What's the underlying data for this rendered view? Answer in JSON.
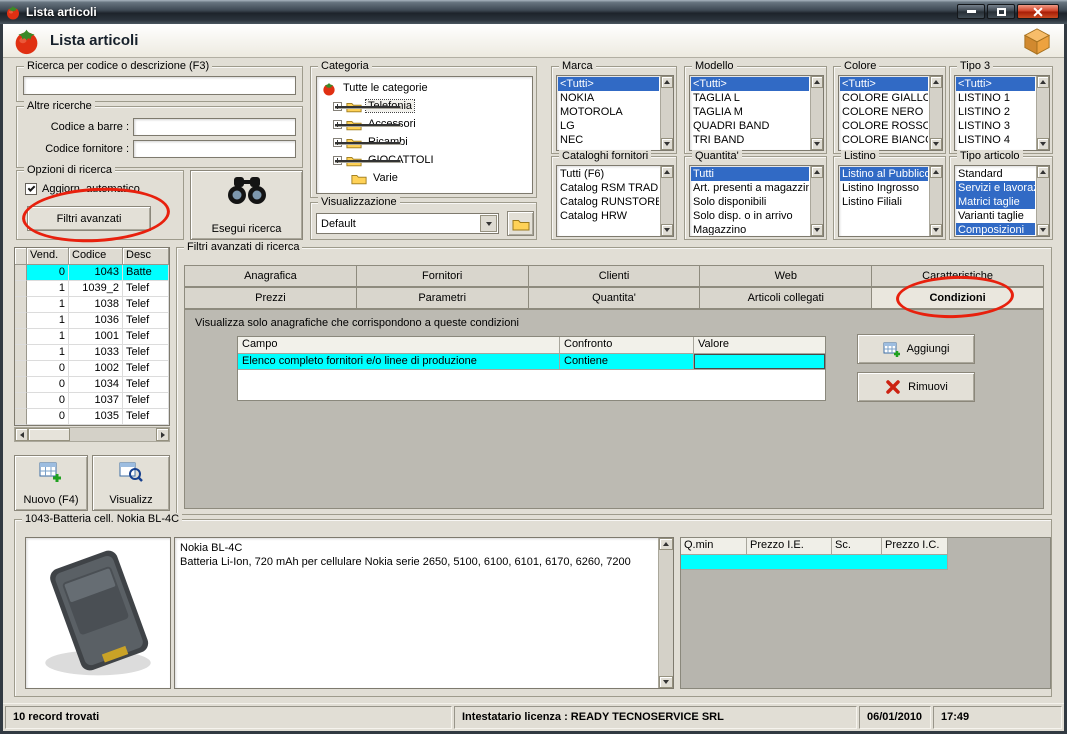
{
  "titlebar": {
    "title": "Lista articoli"
  },
  "header": {
    "title": "Lista articoli"
  },
  "colors": {
    "selection_blue": "#316AC5",
    "row_highlight_cyan": "#00FFFF",
    "annotation_red": "#E8200D",
    "window_gray": "#E1DED5",
    "panel_gray": "#BCBAB2"
  },
  "search": {
    "ricerca_group_label": "Ricerca per codice o descrizione (F3)",
    "ricerca_value": "",
    "altre_label": "Altre ricerche",
    "codice_barre_label": "Codice a barre :",
    "codice_barre_value": "",
    "codice_fornitore_label": "Codice fornitore :",
    "codice_fornitore_value": "",
    "opzioni_label": "Opzioni di ricerca",
    "aggiorn_checkbox_label": "Aggiorn. automatico",
    "filtri_avanzati_label": "Filtri avanzati",
    "esegui_label": "Esegui ricerca"
  },
  "categoria": {
    "group_label": "Categoria",
    "items": [
      {
        "label": "Tutte le categorie"
      },
      {
        "label": "Telefonia"
      },
      {
        "label": "Accessori"
      },
      {
        "label": "Ricambi"
      },
      {
        "label": "GIOCATTOLI"
      },
      {
        "label": "Varie"
      }
    ]
  },
  "visualizzazione": {
    "group_label": "Visualizzazione",
    "value": "Default"
  },
  "filters": {
    "marca": {
      "label": "Marca",
      "items": [
        {
          "label": "<Tutti>",
          "sel": true
        },
        {
          "label": "NOKIA"
        },
        {
          "label": "MOTOROLA"
        },
        {
          "label": "LG"
        },
        {
          "label": "NEC"
        }
      ]
    },
    "modello": {
      "label": "Modello",
      "items": [
        {
          "label": "<Tutti>",
          "sel": true
        },
        {
          "label": "TAGLIA L"
        },
        {
          "label": "TAGLIA M"
        },
        {
          "label": "QUADRI BAND"
        },
        {
          "label": "TRI BAND"
        }
      ]
    },
    "colore": {
      "label": "Colore",
      "items": [
        {
          "label": "<Tutti>",
          "sel": true
        },
        {
          "label": "COLORE GIALLO"
        },
        {
          "label": "COLORE NERO"
        },
        {
          "label": "COLORE ROSSO"
        },
        {
          "label": "COLORE BIANCO"
        }
      ]
    },
    "tipo3": {
      "label": "Tipo 3",
      "items": [
        {
          "label": "<Tutti>",
          "sel": true
        },
        {
          "label": "LISTINO 1"
        },
        {
          "label": "LISTINO 2"
        },
        {
          "label": "LISTINO 3"
        },
        {
          "label": "LISTINO 4"
        }
      ]
    },
    "cataloghi": {
      "label": "Cataloghi fornitori",
      "items": [
        {
          "label": "Tutti (F6)"
        },
        {
          "label": "Catalog RSM TRADE"
        },
        {
          "label": "Catalog RUNSTORE"
        },
        {
          "label": "Catalog HRW"
        }
      ]
    },
    "quantita": {
      "label": "Quantita'",
      "items": [
        {
          "label": "Tutti",
          "sel": true
        },
        {
          "label": "Art. presenti a magazzino"
        },
        {
          "label": "Solo disponibili"
        },
        {
          "label": "Solo disp. o in arrivo"
        },
        {
          "label": "Magazzino"
        }
      ]
    },
    "listino": {
      "label": "Listino",
      "items": [
        {
          "label": "Listino al Pubblico",
          "sel": true
        },
        {
          "label": "Listino Ingrosso"
        },
        {
          "label": "Listino Filiali"
        }
      ]
    },
    "tipo_articolo": {
      "label": "Tipo articolo",
      "items": [
        {
          "label": "Standard"
        },
        {
          "label": "Servizi e lavorazioni",
          "sel": true
        },
        {
          "label": "Matrici taglie",
          "sel": true
        },
        {
          "label": "Varianti taglie"
        },
        {
          "label": "Composizioni",
          "sel": true
        }
      ]
    }
  },
  "results": {
    "columns": [
      "Vend.",
      "Codice",
      "Desc"
    ],
    "rows": [
      {
        "vend": "0",
        "codice": "1043",
        "desc": "Batte",
        "sel": true
      },
      {
        "vend": "1",
        "codice": "1039_2",
        "desc": "Telef"
      },
      {
        "vend": "1",
        "codice": "1038",
        "desc": "Telef"
      },
      {
        "vend": "1",
        "codice": "1036",
        "desc": "Telef"
      },
      {
        "vend": "1",
        "codice": "1001",
        "desc": "Telef"
      },
      {
        "vend": "1",
        "codice": "1033",
        "desc": "Telef"
      },
      {
        "vend": "0",
        "codice": "1002",
        "desc": "Telef"
      },
      {
        "vend": "0",
        "codice": "1034",
        "desc": "Telef"
      },
      {
        "vend": "0",
        "codice": "1037",
        "desc": "Telef"
      },
      {
        "vend": "0",
        "codice": "1035",
        "desc": "Telef"
      }
    ]
  },
  "actions": {
    "nuovo_label": "Nuovo (F4)",
    "visualizza_label": "Visualizz"
  },
  "filtri_panel": {
    "group_label": "Filtri avanzati di ricerca",
    "tabs_row1": [
      {
        "label": "Anagrafica"
      },
      {
        "label": "Fornitori"
      },
      {
        "label": "Clienti"
      },
      {
        "label": "Web"
      },
      {
        "label": "Caratteristiche"
      }
    ],
    "tabs_row2": [
      {
        "label": "Prezzi"
      },
      {
        "label": "Parametri"
      },
      {
        "label": "Quantita'"
      },
      {
        "label": "Articoli collegati"
      },
      {
        "label": "Condizioni",
        "sel": true
      }
    ],
    "description": "Visualizza solo anagrafiche che corrispondono a queste condizioni",
    "grid": {
      "col_campo": "Campo",
      "col_confronto": "Confronto",
      "col_valore": "Valore",
      "row_campo": "Elenco completo fornitori e/o linee di produzione",
      "row_confronto": "Contiene",
      "row_valore": ""
    },
    "aggiungi_label": "Aggiungi",
    "rimuovi_label": "Rimuovi"
  },
  "detail": {
    "group_label": "1043-Batteria cell. Nokia BL-4C",
    "desc_line1": "Nokia BL-4C",
    "desc_line2": "Batteria Li-Ion, 720 mAh per cellulare Nokia serie 2650, 5100, 6100, 6101, 6170, 6260, 7200",
    "price_columns": [
      {
        "label": "Q.min"
      },
      {
        "label": "Prezzo I.E."
      },
      {
        "label": "Sc."
      },
      {
        "label": "Prezzo I.C."
      }
    ]
  },
  "statusbar": {
    "records": "10 record trovati",
    "license": "Intestatario licenza : READY TECNOSERVICE SRL",
    "date": "06/01/2010",
    "time": "17:49"
  }
}
